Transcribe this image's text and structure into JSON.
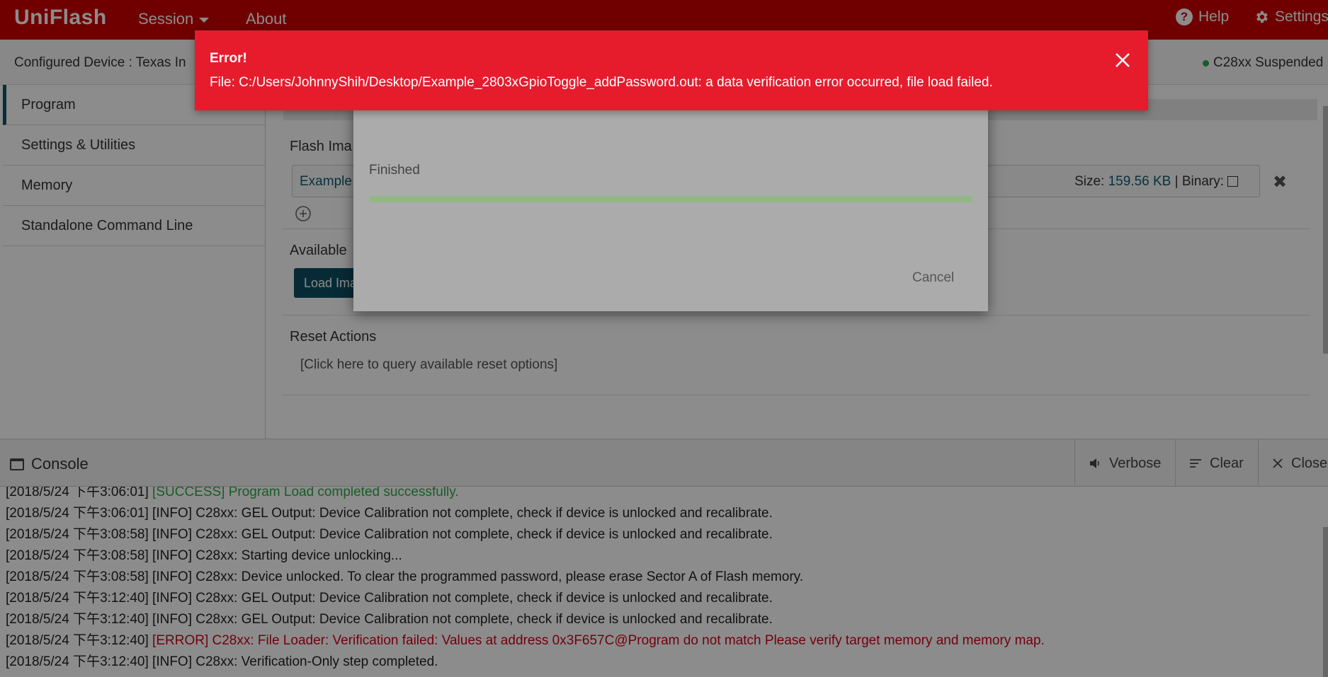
{
  "app": {
    "brand": "UniFlash",
    "menu_session": "Session",
    "menu_about": "About",
    "help": "Help",
    "settings": "Settings"
  },
  "device": {
    "configured": "Configured Device : Texas In",
    "status": "C28xx Suspended",
    "status_color": "#2ea84a"
  },
  "sidebar": {
    "items": [
      {
        "label": "Program"
      },
      {
        "label": "Settings & Utilities"
      },
      {
        "label": "Memory"
      },
      {
        "label": "Standalone Command Line"
      }
    ]
  },
  "main": {
    "flash_label": "Flash Ima",
    "file_name": "Example",
    "size_label": "Size: ",
    "size_value": "159.56 KB",
    "binary_label": " | Binary:",
    "available_label": "Available",
    "load_button": "Load Ima",
    "reset_label": "Reset Actions",
    "reset_link": "[Click here to query available reset options]"
  },
  "dialog": {
    "status": "Finished",
    "progress": 1.0,
    "cancel": "Cancel"
  },
  "toast": {
    "title": "Error!",
    "message": "File: C:/Users/JohnnyShih/Desktop/Example_2803xGpioToggle_addPassword.out: a data verification error occurred, file load failed."
  },
  "console": {
    "title": "Console",
    "verbose": "Verbose",
    "clear": "Clear",
    "close": "Close",
    "lines": [
      {
        "ts": "[2018/5/24 下午3:06:01] ",
        "msg": "[SUCCESS] Program Load completed successfully.",
        "level": "success"
      },
      {
        "ts": "[2018/5/24 下午3:06:01] ",
        "msg": "[INFO] C28xx: GEL Output: Device Calibration not complete, check if device is unlocked and recalibrate.",
        "level": "info"
      },
      {
        "ts": "[2018/5/24 下午3:08:58] ",
        "msg": "[INFO] C28xx: GEL Output: Device Calibration not complete, check if device is unlocked and recalibrate.",
        "level": "info"
      },
      {
        "ts": "[2018/5/24 下午3:08:58] ",
        "msg": "[INFO] C28xx: Starting device unlocking...",
        "level": "info"
      },
      {
        "ts": "[2018/5/24 下午3:08:58] ",
        "msg": "[INFO] C28xx: Device unlocked. To clear the programmed password, please erase Sector A of Flash memory.",
        "level": "info"
      },
      {
        "ts": "[2018/5/24 下午3:12:40] ",
        "msg": "[INFO] C28xx: GEL Output: Device Calibration not complete, check if device is unlocked and recalibrate.",
        "level": "info"
      },
      {
        "ts": "[2018/5/24 下午3:12:40] ",
        "msg": "[INFO] C28xx: GEL Output: Device Calibration not complete, check if device is unlocked and recalibrate.",
        "level": "info"
      },
      {
        "ts": "[2018/5/24 下午3:12:40] ",
        "msg": "[ERROR] C28xx: File Loader: Verification failed: Values at address 0x3F657C@Program do not match Please verify target memory and memory map.",
        "level": "error"
      },
      {
        "ts": "[2018/5/24 下午3:12:40] ",
        "msg": "[INFO] C28xx: Verification-Only step completed.",
        "level": "info"
      }
    ]
  },
  "colors": {
    "brand_red": "#cc0000",
    "toast_red": "#e61c2d",
    "accent_teal": "#0e4f63",
    "success_green": "#2ea84a",
    "error_red": "#d0021b"
  }
}
